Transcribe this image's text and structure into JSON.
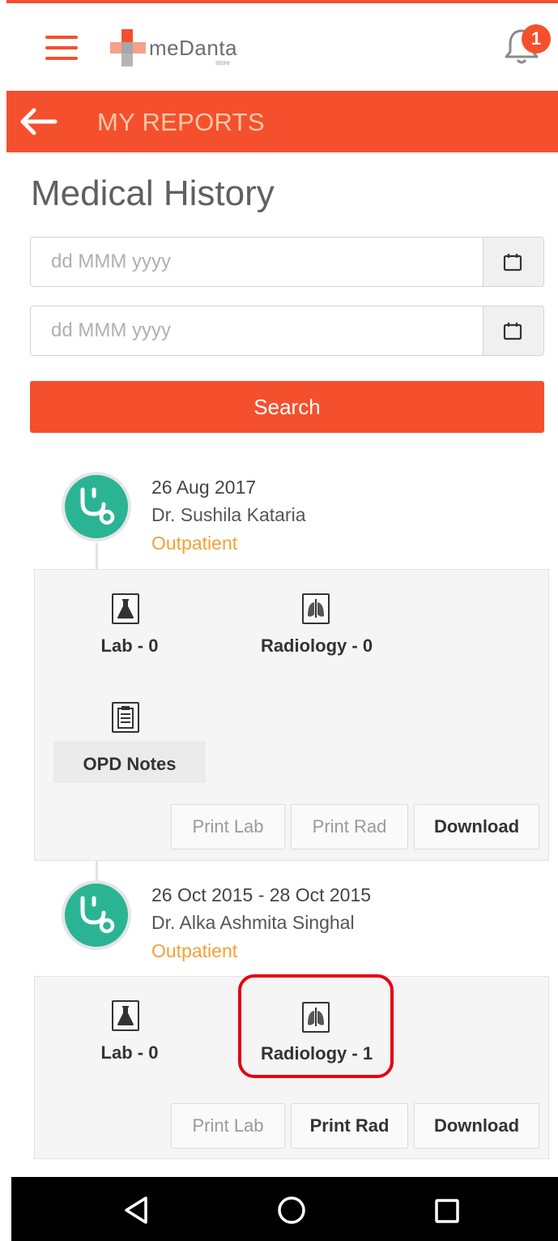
{
  "header": {
    "logo_text": "meDanta",
    "logo_subtext": "store",
    "notification_count": "1"
  },
  "topbar": {
    "title": "MY REPORTS"
  },
  "page": {
    "title": "Medical History"
  },
  "filters": {
    "from_placeholder": "dd MMM yyyy",
    "to_placeholder": "dd MMM yyyy",
    "search_label": "Search"
  },
  "entries": [
    {
      "date": "26 Aug 2017",
      "doctor": "Dr. Sushila Kataria",
      "type": "Outpatient",
      "lab_label": "Lab - 0",
      "radiology_label": "Radiology - 0",
      "opd_label": "OPD Notes",
      "print_lab": "Print Lab",
      "print_rad": "Print Rad",
      "download": "Download"
    },
    {
      "date": "26 Oct 2015 - 28 Oct 2015",
      "doctor": "Dr. Alka Ashmita Singhal",
      "type": "Outpatient",
      "lab_label": "Lab - 0",
      "radiology_label": "Radiology - 1",
      "print_lab": "Print Lab",
      "print_rad": "Print Rad",
      "download": "Download"
    }
  ],
  "colors": {
    "brand_orange": "#f4502e",
    "avatar_green": "#2bb493",
    "outpatient_text": "#f5a033",
    "highlight_red": "#e60012"
  },
  "icons": {
    "menu": "hamburger-icon",
    "notification": "bell-icon",
    "back": "arrow-left-icon",
    "calendar": "calendar-icon",
    "doctor": "stethoscope-icon",
    "lab": "flask-icon",
    "radiology": "xray-icon",
    "opd": "clipboard-icon"
  }
}
